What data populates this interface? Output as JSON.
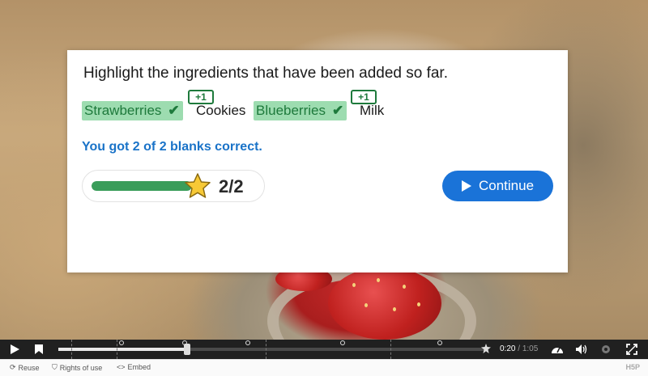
{
  "question": "Highlight the ingredients that have been added so far.",
  "words": [
    {
      "text": "Strawberries",
      "highlighted": true,
      "correct": true
    },
    {
      "text": "Cookies",
      "highlighted": false
    },
    {
      "text": "Blueberries",
      "highlighted": true,
      "correct": true
    },
    {
      "text": "Milk",
      "highlighted": false
    }
  ],
  "score_badge": "+1",
  "feedback": "You got 2 of 2 blanks correct.",
  "score": {
    "text": "2/2",
    "fraction": 1.0
  },
  "continue_label": "Continue",
  "player": {
    "current_time": "0:20",
    "separator": " / ",
    "duration": "1:05",
    "progress_fraction": 0.3
  },
  "footer": {
    "reuse": "Reuse",
    "rights": "Rights of use",
    "embed": "Embed",
    "brand": "H5P"
  },
  "colors": {
    "accent": "#1a73d8",
    "correct": "#1e7a3c",
    "highlight": "#9ddcb0"
  },
  "icons": [
    "play-icon",
    "bookmark-icon",
    "star-icon",
    "check-icon",
    "speed-icon",
    "volume-icon",
    "settings-icon",
    "fullscreen-icon",
    "reuse-icon",
    "rights-icon",
    "embed-icon"
  ]
}
